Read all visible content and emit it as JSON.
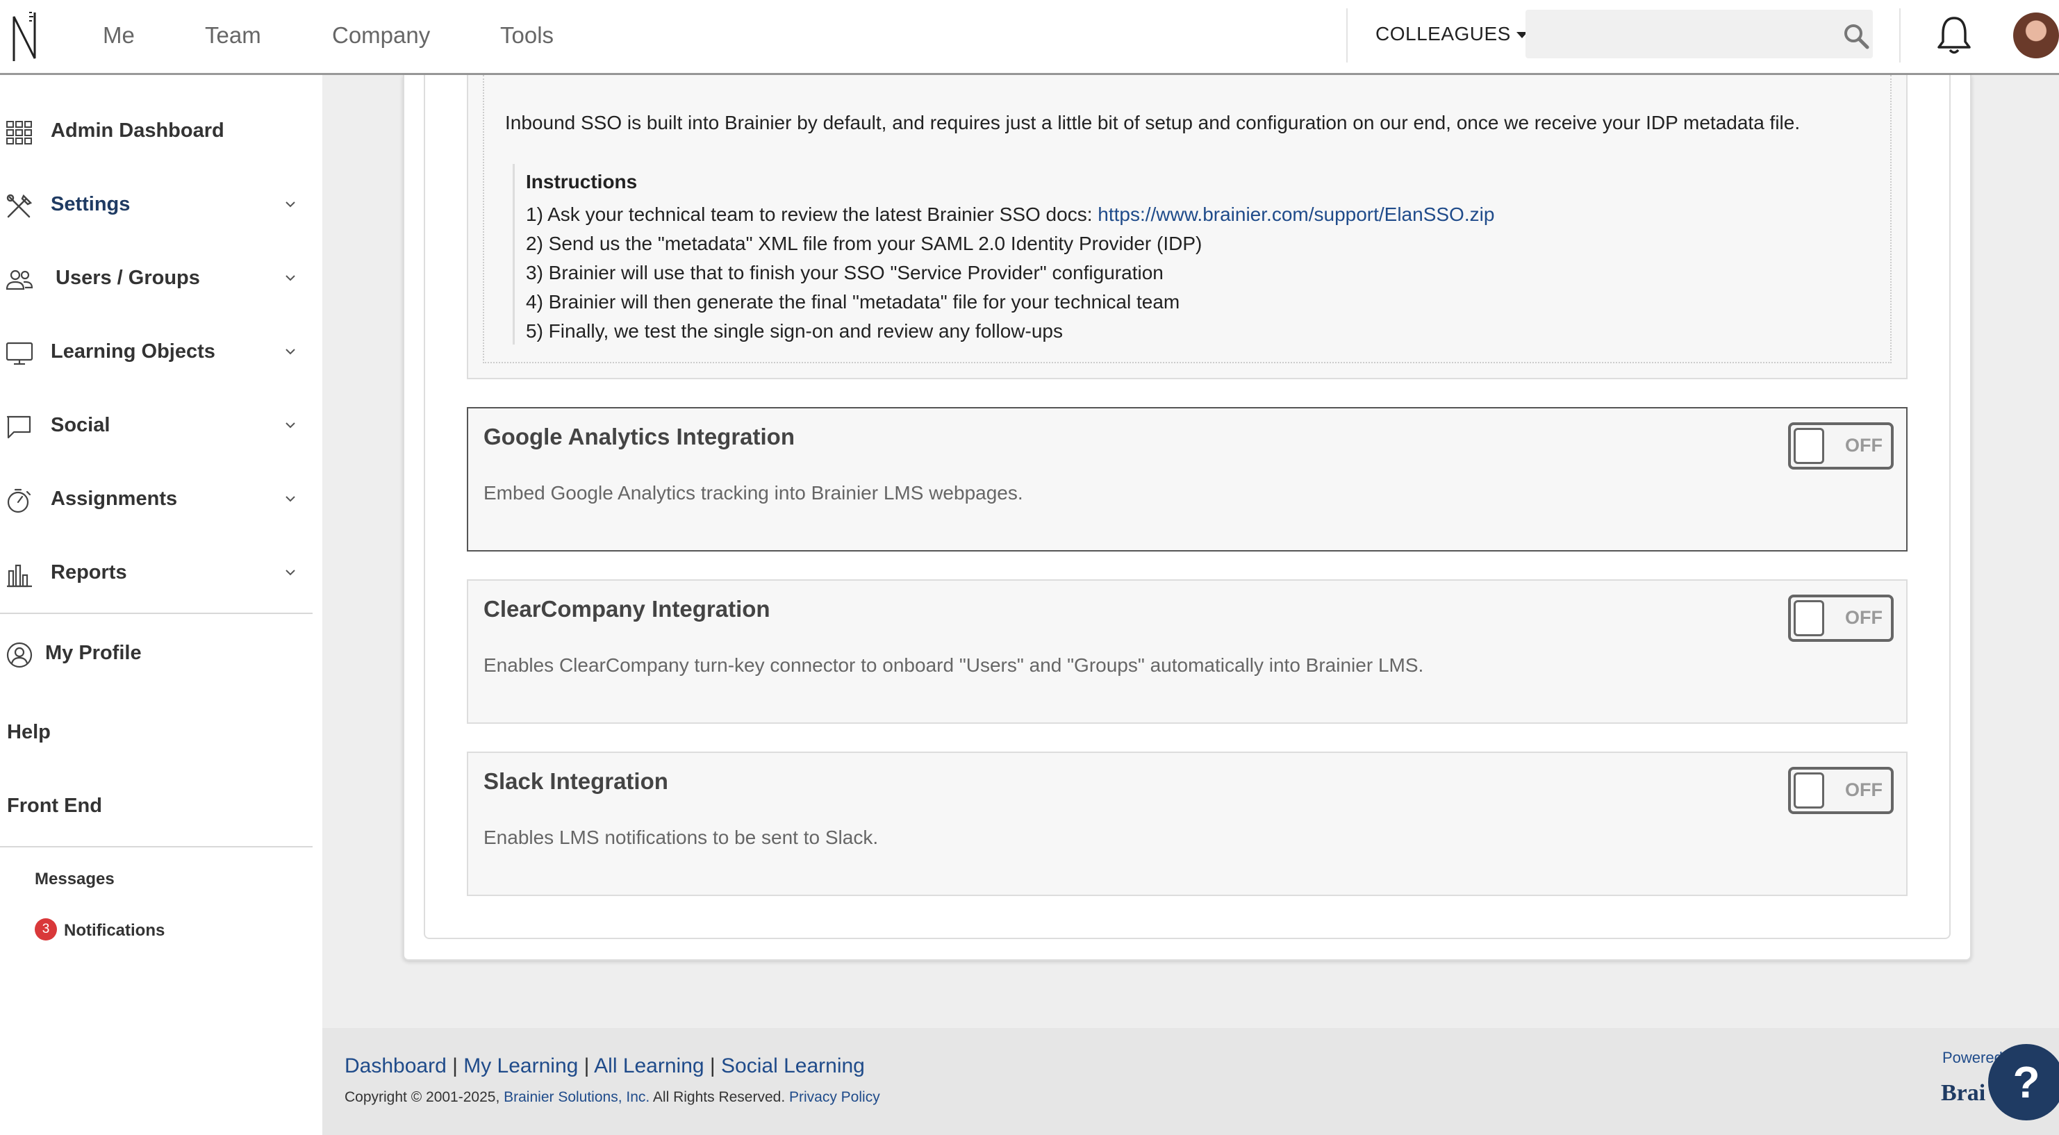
{
  "nav": {
    "items": [
      "Me",
      "Team",
      "Company",
      "Tools"
    ],
    "colleagues_label": "COLLEAGUES",
    "search_placeholder": ""
  },
  "sidebar": {
    "items": [
      {
        "label": "Admin Dashboard",
        "icon": "grid-icon",
        "expandable": false
      },
      {
        "label": "Settings",
        "icon": "tools-icon",
        "expandable": true
      },
      {
        "label": "Users / Groups",
        "icon": "users-icon",
        "expandable": true
      },
      {
        "label": "Learning Objects",
        "icon": "monitor-icon",
        "expandable": true
      },
      {
        "label": "Social",
        "icon": "chat-icon",
        "expandable": true
      },
      {
        "label": "Assignments",
        "icon": "stopwatch-icon",
        "expandable": true
      },
      {
        "label": "Reports",
        "icon": "bar-chart-icon",
        "expandable": true
      }
    ],
    "my_profile": "My Profile",
    "help": "Help",
    "front_end": "Front End",
    "messages": "Messages",
    "notifications": "Notifications",
    "notifications_count": "3"
  },
  "sso": {
    "intro": "Inbound SSO is built into Brainier by default, and requires just a little bit of setup and configuration on our end, once we receive your IDP metadata file.",
    "instructions_title": "Instructions",
    "step1_prefix": "1) Ask your technical team to review the latest Brainier SSO docs: ",
    "step1_link": "https://www.brainier.com/support/ElanSSO.zip",
    "step2": "2) Send us the \"metadata\" XML file from your SAML 2.0 Identity Provider (IDP)",
    "step3": "3) Brainier will use that to finish your SSO \"Service Provider\" configuration",
    "step4": "4) Brainier will then generate the final \"metadata\" file for your technical team",
    "step5": "5) Finally, we test the single sign-on and review any follow-ups"
  },
  "integrations": [
    {
      "title": "Google Analytics Integration",
      "description": "Embed Google Analytics tracking into Brainier LMS webpages.",
      "state": "OFF"
    },
    {
      "title": "ClearCompany Integration",
      "description": "Enables ClearCompany turn-key connector to onboard \"Users\" and \"Groups\" automatically into Brainier LMS.",
      "state": "OFF"
    },
    {
      "title": "Slack Integration",
      "description": "Enables LMS notifications to be sent to Slack.",
      "state": "OFF"
    }
  ],
  "footer": {
    "links": [
      "Dashboard",
      "My Learning",
      "All Learning",
      "Social Learning"
    ],
    "copyright_prefix": "Copyright © 2001-2025, ",
    "company": "Brainier Solutions, Inc.",
    "rights": " All Rights Reserved. ",
    "privacy": "Privacy Policy",
    "powered": "Powered",
    "brand": "Brai",
    "help_glyph": "?"
  }
}
